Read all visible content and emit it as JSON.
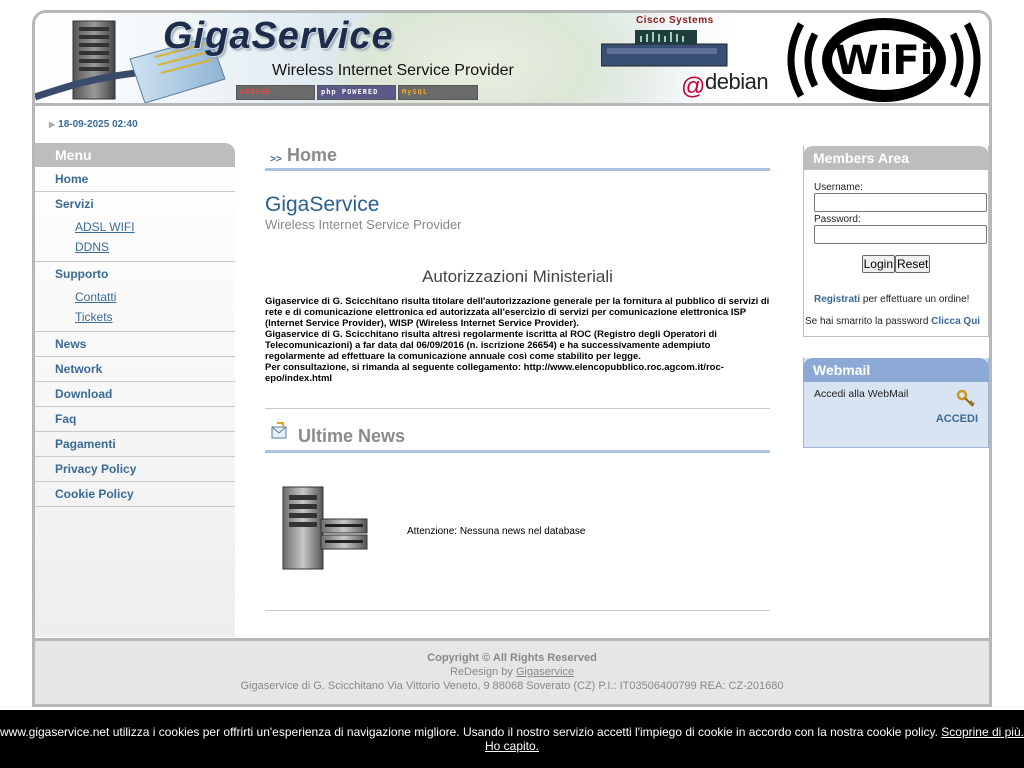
{
  "banner": {
    "title": "GigaService",
    "subtitle": "Wireless Internet Service Provider",
    "badges": [
      "APACHE",
      "php POWERED",
      "MySQL"
    ],
    "cisco": "Cisco Systems",
    "debian": "debian",
    "wifi": "WiFi"
  },
  "datetime": "18-09-2025 02:40",
  "menu": {
    "heading": "Menu",
    "items": {
      "home": "Home",
      "servizi": "Servizi",
      "adsl_wifi": "ADSL WIFI",
      "ddns": "DDNS",
      "supporto": "Supporto",
      "contatti": "Contatti",
      "tickets": "Tickets",
      "news": "News",
      "network": "Network",
      "download": "Download",
      "faq": "Faq",
      "pagamenti": "Pagamenti",
      "privacy": "Privacy Policy",
      "cookie": "Cookie Policy"
    }
  },
  "main": {
    "section_title": "Home",
    "section_arrow": ">>",
    "site_name": "GigaService",
    "site_tagline": "Wireless Internet Service Provider",
    "auth_title": "Autorizzazioni Ministeriali",
    "auth_p1": "Gigaservice di G. Scicchitano risulta titolare dell'autorizzazione generale per la fornitura al pubblico di servizi di rete e di comunicazione elettronica ed autorizzata all'esercizio di servizi per comunicazione elettronica ISP (Internet Service Provider), WISP (Wireless Internet Service Provider).",
    "auth_p2": "Gigaservice di G. Scicchitano risulta altresì regolarmente iscritta al ROC (Registro degli Operatori di Telecomunicazioni) a far data dal 06/09/2016 (n. iscrizione 26654) e ha successivamente adempiuto regolarmente ad effettuare la comunicazione annuale così come stabilito per legge.",
    "auth_p3": "Per consultazione, si rimanda al seguente collegamento: http://www.elencopubblico.roc.agcom.it/roc-epo/index.html",
    "news_title": "Ultime News",
    "news_empty": "Attenzione: Nessuna news nel database"
  },
  "members": {
    "heading": "Members Area",
    "username_label": "Username:",
    "password_label": "Password:",
    "username_value": "",
    "password_value": "",
    "login": "Login",
    "reset": "Reset",
    "register_link": "Registrati",
    "register_text": " per effettuare un ordine!",
    "lost_text": "Se hai smarrito la password ",
    "lost_link": "Clicca Qui"
  },
  "webmail": {
    "heading": "Webmail",
    "text": "Accedi alla WebMail",
    "link": "ACCEDI",
    "icon": "key-icon"
  },
  "footer": {
    "copyright": "Copyright © All Rights Reserved",
    "redesign_prefix": "ReDesign by ",
    "redesign_link": "Gigaservice",
    "address": "Gigaservice di G. Scicchitano Via Vittorio Veneto, 9 88068 Soverato (CZ) P.I.: IT03506400799 REA: CZ-201680"
  },
  "cookie_bar": {
    "text": "www.gigaservice.net utilizza i cookies per offrirti un'esperienza di navigazione migliore. Usando il nostro servizio accetti l'impiego di cookie in accordo con la nostra cookie policy. ",
    "more_link": "Scoprine di più.",
    "ok_link": "Ho capito."
  },
  "colors": {
    "accent_blue": "#3a6a95",
    "title_blue": "#2a5f8f",
    "header_grey": "#bdbdbd",
    "webmail_blue": "#8ca9d6",
    "rule_blue": "#aac6e0"
  }
}
